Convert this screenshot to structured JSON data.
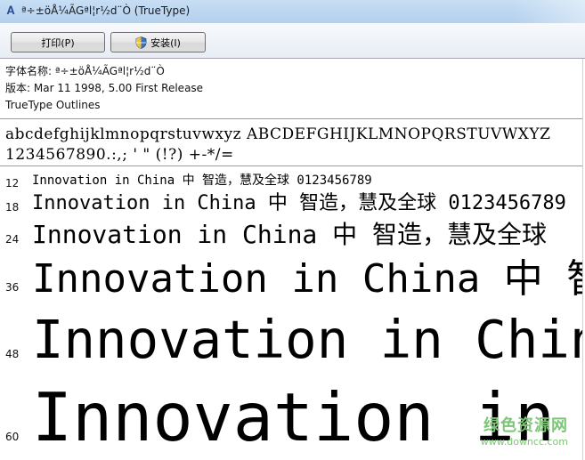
{
  "window": {
    "icon": "font-file-icon",
    "title": "ª÷±öÅ¼ÃGªl¦r½d¨Ò (TrueType)"
  },
  "toolbar": {
    "print_label": "打印(P)",
    "install_label": "安装(I)"
  },
  "font_info": {
    "name_line": "字体名称: ª÷±öÅ¼ÃGªl¦r½d¨Ò",
    "version_line": "版本: Mar 11 1998, 5.00 First Release",
    "type_line": "TrueType Outlines"
  },
  "charset": {
    "line1": "abcdefghijklmnopqrstuvwxyz ABCDEFGHIJKLMNOPQRSTUVWXYZ",
    "line2": "1234567890.:,; ' \" (!?) +-*/="
  },
  "samples": [
    {
      "size": "12",
      "text": "Innovation in China 中  智造，慧及全球 0123456789"
    },
    {
      "size": "18",
      "text": "Innovation in China 中  智造，慧及全球 0123456789"
    },
    {
      "size": "24",
      "text": "Innovation in China 中  智造，慧及全球"
    },
    {
      "size": "36",
      "text": "Innovation in China 中  智"
    },
    {
      "size": "48",
      "text": "Innovation in China"
    },
    {
      "size": "60",
      "text": "Innovation in Ch"
    }
  ],
  "watermark": {
    "line1": "绿色资源网",
    "line2": "www.downcc.com"
  },
  "colors": {
    "titlebar": "#b3d0ee",
    "watermark": "#7cc576"
  }
}
